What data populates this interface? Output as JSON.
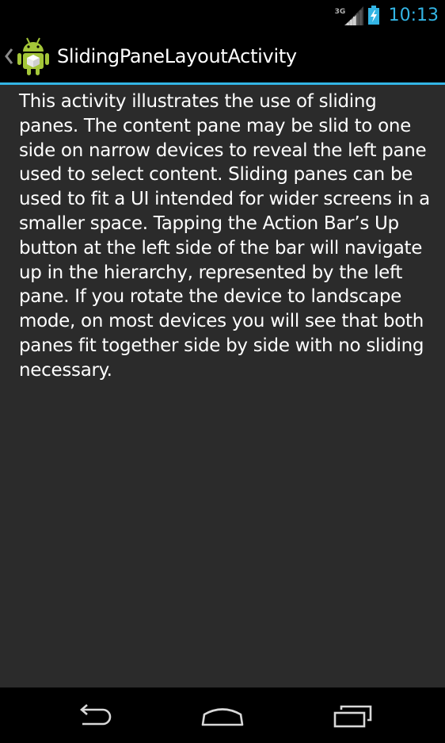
{
  "status_bar": {
    "network_type": "3G",
    "time": "10:13",
    "icons": [
      "signal-icon",
      "battery-charging-icon"
    ]
  },
  "action_bar": {
    "title": "SlidingPaneLayoutActivity",
    "icons": [
      "up-chevron-icon",
      "android-app-icon"
    ]
  },
  "content": {
    "description": "This activity illustrates the use of sliding panes. The content pane may be slid to one side on narrow devices to reveal the left pane used to select content. Sliding panes can be used to fit a UI intended for wider screens in a smaller space. Tapping the Action Bar’s Up button at the left side of the bar will navigate up in the hierarchy, represented by the left pane. If you rotate the device to landscape mode, on most devices you will see that both panes fit together side by side with no sliding necessary."
  },
  "nav_bar": {
    "buttons": [
      "back-icon",
      "home-icon",
      "recent-apps-icon"
    ]
  },
  "colors": {
    "accent": "#33b5e5",
    "content_background": "#2b2b2b",
    "bar_background": "#000000",
    "text": "#ffffff"
  }
}
